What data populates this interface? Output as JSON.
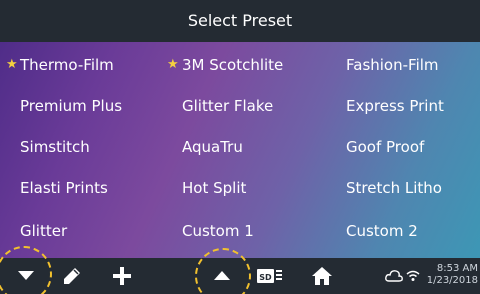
{
  "title": "Select Preset",
  "presets": [
    [
      {
        "label": "Thermo-Film",
        "favorite": true
      },
      {
        "label": "3M Scotchlite",
        "favorite": true
      },
      {
        "label": "Fashion-Film",
        "favorite": false
      }
    ],
    [
      {
        "label": "Premium Plus",
        "favorite": false
      },
      {
        "label": "Glitter Flake",
        "favorite": false
      },
      {
        "label": "Express Print",
        "favorite": false
      }
    ],
    [
      {
        "label": "Simstitch",
        "favorite": false
      },
      {
        "label": "AquaTru",
        "favorite": false
      },
      {
        "label": "Goof Proof",
        "favorite": false
      }
    ],
    [
      {
        "label": "Elasti Prints",
        "favorite": false
      },
      {
        "label": "Hot Split",
        "favorite": false
      },
      {
        "label": "Stretch Litho",
        "favorite": false
      }
    ],
    [
      {
        "label": "Glitter",
        "favorite": false
      },
      {
        "label": "Custom 1",
        "favorite": false
      },
      {
        "label": "Custom 2",
        "favorite": false
      }
    ]
  ],
  "toolbar": {
    "icons": [
      "chevron-down-icon",
      "pencil-icon",
      "plus-icon",
      "chevron-up-icon",
      "sd-card-icon",
      "home-icon",
      "cloud-icon",
      "wifi-icon"
    ],
    "sd_label": "SD",
    "time": "8:53 AM",
    "date": "1/23/2018"
  },
  "colors": {
    "star": "#f4d03f",
    "highlight": "#f2c12e",
    "bar": "#242b33"
  }
}
